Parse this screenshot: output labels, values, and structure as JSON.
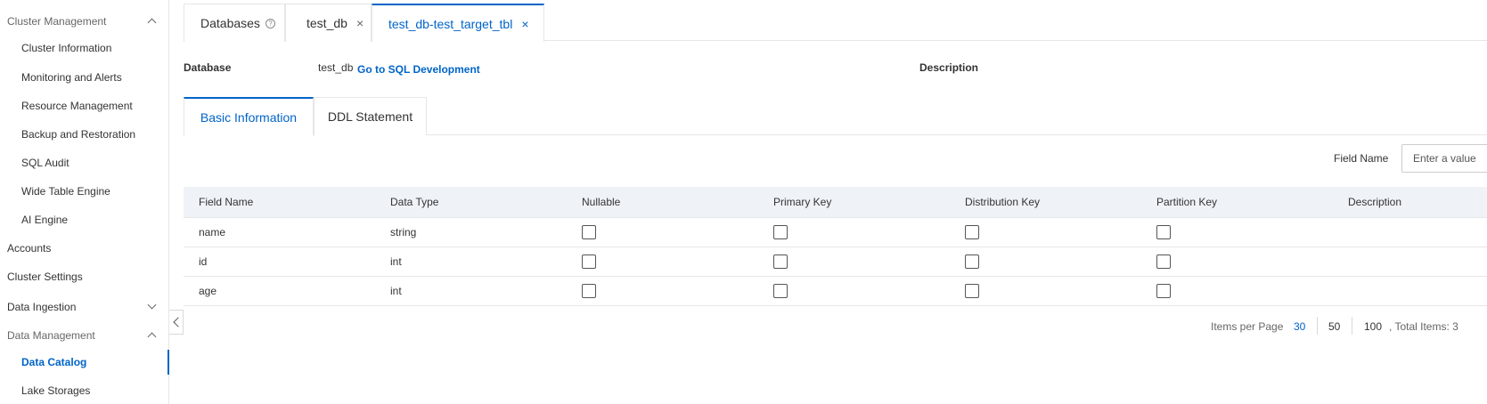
{
  "sidebar": {
    "cluster_management": "Cluster Management",
    "cluster_information": "Cluster Information",
    "monitoring_alerts": "Monitoring and Alerts",
    "resource_management": "Resource Management",
    "backup_restoration": "Backup and Restoration",
    "sql_audit": "SQL Audit",
    "wide_table_engine": "Wide Table Engine",
    "ai_engine": "AI Engine",
    "accounts": "Accounts",
    "cluster_settings": "Cluster Settings",
    "data_ingestion": "Data Ingestion",
    "data_management": "Data Management",
    "data_catalog": "Data Catalog",
    "lake_storages": "Lake Storages"
  },
  "tabs": {
    "databases": "Databases",
    "test_db": "test_db",
    "target_tbl": "test_db-test_target_tbl",
    "close_glyph": "×",
    "help_glyph": "?"
  },
  "info": {
    "database_label": "Database",
    "database_value": "test_db",
    "sql_link": "Go to SQL Development",
    "description_label": "Description"
  },
  "subtabs": {
    "basic": "Basic Information",
    "ddl": "DDL Statement"
  },
  "filter": {
    "label": "Field Name",
    "placeholder": "Enter a value"
  },
  "table": {
    "headers": {
      "field_name": "Field Name",
      "data_type": "Data Type",
      "nullable": "Nullable",
      "primary_key": "Primary Key",
      "distribution_key": "Distribution Key",
      "partition_key": "Partition Key",
      "description": "Description"
    },
    "rows": [
      {
        "name": "name",
        "type": "string",
        "nullable": false,
        "primary": false,
        "distribution": false,
        "partition": false
      },
      {
        "name": "id",
        "type": "int",
        "nullable": false,
        "primary": false,
        "distribution": false,
        "partition": false
      },
      {
        "name": "age",
        "type": "int",
        "nullable": false,
        "primary": false,
        "distribution": false,
        "partition": false
      }
    ]
  },
  "pagination": {
    "items_per_page": "Items per Page",
    "opt_30": "30",
    "opt_50": "50",
    "opt_100": "100",
    "total": ", Total Items: 3"
  },
  "colors": {
    "accent": "#0064c8",
    "header_bg": "#eff3f8",
    "border": "#e6e6e6"
  }
}
